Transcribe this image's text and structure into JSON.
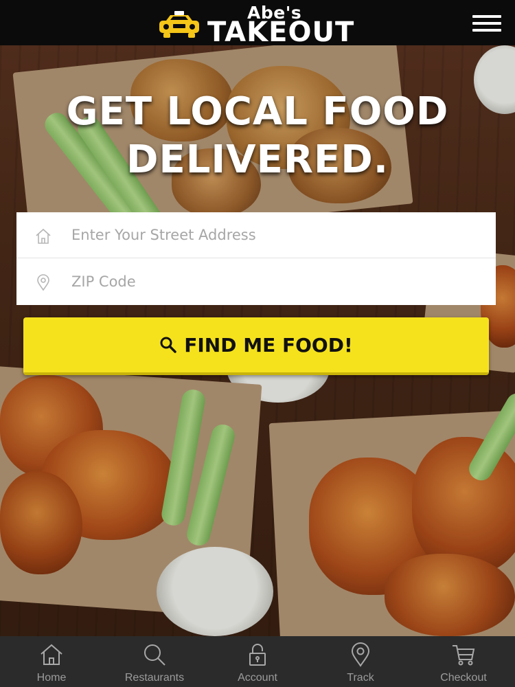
{
  "header": {
    "brand_top": "Abe's",
    "brand_main": "TAKEOUT",
    "menu_icon": "hamburger-menu-icon"
  },
  "hero": {
    "headline_line1": "GET LOCAL FOOD",
    "headline_line2": "DELIVERED."
  },
  "form": {
    "address": {
      "placeholder": "Enter Your Street Address",
      "value": "",
      "icon": "home-icon"
    },
    "zip": {
      "placeholder": "ZIP Code",
      "value": "",
      "icon": "map-pin-icon"
    },
    "submit_label": "FIND ME FOOD!",
    "submit_icon": "search-icon"
  },
  "tabbar": {
    "items": [
      {
        "label": "Home",
        "icon": "home-icon"
      },
      {
        "label": "Restaurants",
        "icon": "search-icon"
      },
      {
        "label": "Account",
        "icon": "lock-icon"
      },
      {
        "label": "Track",
        "icon": "map-pin-icon"
      },
      {
        "label": "Checkout",
        "icon": "cart-icon"
      }
    ]
  },
  "colors": {
    "accent_yellow": "#f5e21d",
    "header_bg": "#0b0b0b",
    "tabbar_bg": "#2b2b2b"
  }
}
